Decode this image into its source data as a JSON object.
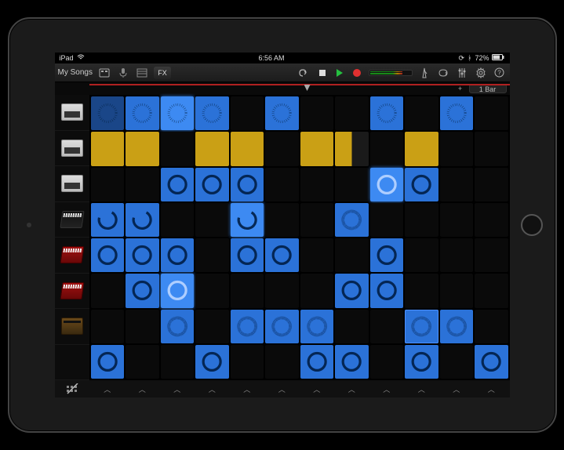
{
  "status": {
    "device": "iPad",
    "time": "6:56 AM",
    "battery": "72%"
  },
  "toolbar": {
    "back_label": "My Songs",
    "fx_label": "FX"
  },
  "ruler": {
    "bar_label": "1 Bar",
    "add_label": "+",
    "playhead_col": 2
  },
  "tracks": [
    {
      "id": "track-1",
      "instrument": "sampler"
    },
    {
      "id": "track-2",
      "instrument": "sampler"
    },
    {
      "id": "track-3",
      "instrument": "sampler"
    },
    {
      "id": "track-4",
      "instrument": "keys-black"
    },
    {
      "id": "track-5",
      "instrument": "keys-red"
    },
    {
      "id": "track-6",
      "instrument": "keys-red"
    },
    {
      "id": "track-7",
      "instrument": "synth"
    },
    {
      "id": "track-8",
      "instrument": "empty"
    }
  ],
  "grid": {
    "rows": 8,
    "cols": 12,
    "cells": [
      [
        {
          "s": "blue-dim",
          "g": "dots"
        },
        {
          "s": "blue",
          "g": "dots"
        },
        {
          "s": "blue-bright",
          "g": "dots"
        },
        {
          "s": "blue",
          "g": "dots"
        },
        {
          "s": "empty"
        },
        {
          "s": "blue",
          "g": "dots"
        },
        {
          "s": "empty"
        },
        {
          "s": "empty"
        },
        {
          "s": "blue",
          "g": "dots"
        },
        {
          "s": "empty"
        },
        {
          "s": "blue",
          "g": "dots"
        },
        {
          "s": "empty"
        }
      ],
      [
        {
          "s": "yellow"
        },
        {
          "s": "yellow"
        },
        {
          "s": "empty"
        },
        {
          "s": "yellow"
        },
        {
          "s": "yellow"
        },
        {
          "s": "empty"
        },
        {
          "s": "yellow"
        },
        {
          "s": "yellow-half"
        },
        {
          "s": "empty"
        },
        {
          "s": "yellow"
        },
        {
          "s": "empty"
        },
        {
          "s": "empty"
        }
      ],
      [
        {
          "s": "empty"
        },
        {
          "s": "empty"
        },
        {
          "s": "blue",
          "g": "solid"
        },
        {
          "s": "blue",
          "g": "solid"
        },
        {
          "s": "blue",
          "g": "solid"
        },
        {
          "s": "empty"
        },
        {
          "s": "empty"
        },
        {
          "s": "empty"
        },
        {
          "s": "blue-bright",
          "g": "solid-light"
        },
        {
          "s": "blue",
          "g": "solid"
        },
        {
          "s": "empty"
        },
        {
          "s": "empty"
        }
      ],
      [
        {
          "s": "blue",
          "g": "arc"
        },
        {
          "s": "blue",
          "g": "arc"
        },
        {
          "s": "empty"
        },
        {
          "s": "empty"
        },
        {
          "s": "blue-bright",
          "g": "arc"
        },
        {
          "s": "empty"
        },
        {
          "s": "empty"
        },
        {
          "s": "blue",
          "g": "wave"
        },
        {
          "s": "empty"
        },
        {
          "s": "empty"
        },
        {
          "s": "empty"
        },
        {
          "s": "empty"
        }
      ],
      [
        {
          "s": "blue",
          "g": "solid"
        },
        {
          "s": "blue",
          "g": "solid"
        },
        {
          "s": "blue",
          "g": "solid"
        },
        {
          "s": "empty"
        },
        {
          "s": "blue",
          "g": "solid"
        },
        {
          "s": "blue",
          "g": "solid"
        },
        {
          "s": "empty"
        },
        {
          "s": "empty"
        },
        {
          "s": "blue",
          "g": "solid"
        },
        {
          "s": "empty"
        },
        {
          "s": "empty"
        },
        {
          "s": "empty"
        }
      ],
      [
        {
          "s": "empty"
        },
        {
          "s": "blue",
          "g": "solid"
        },
        {
          "s": "blue-bright",
          "g": "solid-light"
        },
        {
          "s": "empty"
        },
        {
          "s": "empty"
        },
        {
          "s": "empty"
        },
        {
          "s": "empty"
        },
        {
          "s": "blue",
          "g": "solid"
        },
        {
          "s": "blue",
          "g": "solid"
        },
        {
          "s": "empty"
        },
        {
          "s": "empty"
        },
        {
          "s": "empty"
        }
      ],
      [
        {
          "s": "empty"
        },
        {
          "s": "empty"
        },
        {
          "s": "blue",
          "g": "wave"
        },
        {
          "s": "empty"
        },
        {
          "s": "blue",
          "g": "wave"
        },
        {
          "s": "blue",
          "g": "wave"
        },
        {
          "s": "blue",
          "g": "wave"
        },
        {
          "s": "empty"
        },
        {
          "s": "empty"
        },
        {
          "s": "blue",
          "g": "wave",
          "o": true
        },
        {
          "s": "blue",
          "g": "wave"
        },
        {
          "s": "empty"
        }
      ],
      [
        {
          "s": "blue",
          "g": "solid"
        },
        {
          "s": "empty"
        },
        {
          "s": "empty"
        },
        {
          "s": "blue",
          "g": "solid"
        },
        {
          "s": "empty"
        },
        {
          "s": "empty"
        },
        {
          "s": "blue",
          "g": "solid"
        },
        {
          "s": "blue",
          "g": "solid"
        },
        {
          "s": "empty"
        },
        {
          "s": "blue",
          "g": "solid"
        },
        {
          "s": "empty"
        },
        {
          "s": "blue",
          "g": "solid"
        }
      ]
    ]
  },
  "bottom": {
    "col_icon": "︿"
  }
}
